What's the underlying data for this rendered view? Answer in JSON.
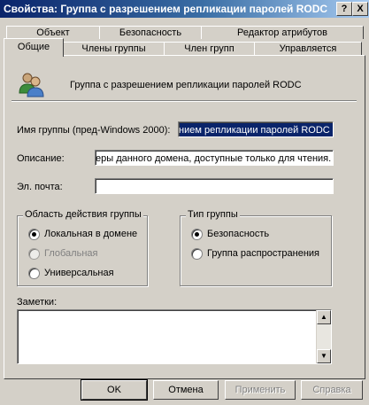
{
  "window": {
    "title": "Свойства: Группа с разрешением репликации паролей RODC",
    "help_button": "?",
    "close_button": "X"
  },
  "tabs_row1": [
    "Объект",
    "Безопасность",
    "Редактор атрибутов"
  ],
  "tabs_row2": [
    "Общие",
    "Члены группы",
    "Член групп",
    "Управляется"
  ],
  "active_tab": "Общие",
  "general": {
    "group_name_display": "Группа с разрешением репликации паролей RODC",
    "pre2000_label": "Имя группы (пред-Windows 2000):",
    "pre2000_value": "нием репликации паролей RODC",
    "description_label": "Описание:",
    "description_value": "еры данного домена, доступные только для чтения.",
    "email_label": "Эл. почта:",
    "email_value": "",
    "scope": {
      "legend": "Область действия группы",
      "options": [
        "Локальная в домене",
        "Глобальная",
        "Универсальная"
      ],
      "selected": "Локальная в домене",
      "disabled": [
        "Глобальная"
      ]
    },
    "type": {
      "legend": "Тип группы",
      "options": [
        "Безопасность",
        "Группа распространения"
      ],
      "selected": "Безопасность"
    },
    "notes_label": "Заметки:",
    "notes_value": ""
  },
  "buttons": {
    "ok": "OK",
    "cancel": "Отмена",
    "apply": "Применить",
    "help": "Справка"
  }
}
